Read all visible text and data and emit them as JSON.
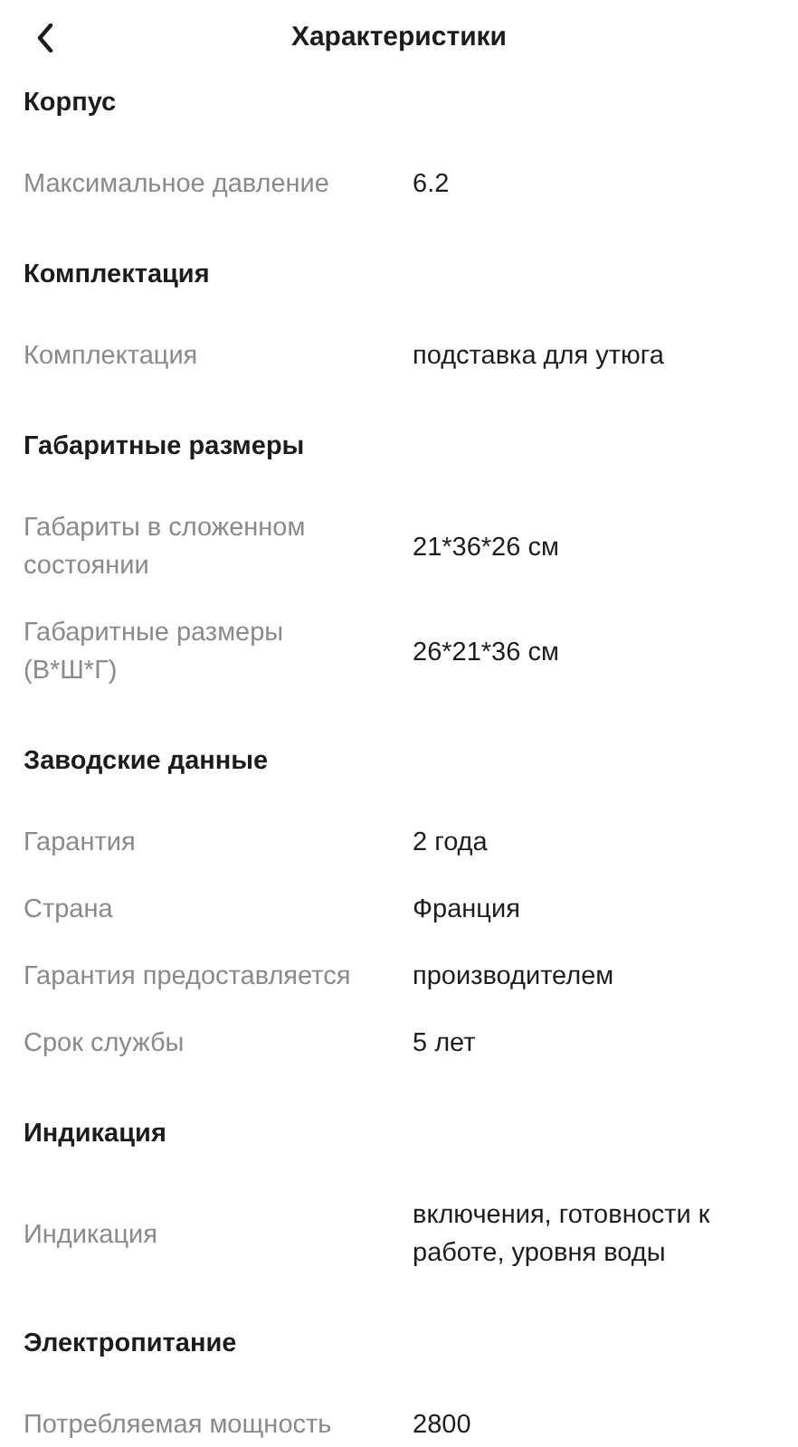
{
  "header": {
    "title": "Характеристики"
  },
  "sections": [
    {
      "title": "Корпус",
      "rows": [
        {
          "label": "Максимальное давление",
          "value": "6.2"
        }
      ]
    },
    {
      "title": "Комплектация",
      "rows": [
        {
          "label": "Комплектация",
          "value": "подставка для утюга"
        }
      ]
    },
    {
      "title": "Габаритные размеры",
      "rows": [
        {
          "label": "Габариты в сложенном состоянии",
          "value": "21*36*26 см"
        },
        {
          "label": "Габаритные размеры (В*Ш*Г)",
          "value": "26*21*36 см"
        }
      ]
    },
    {
      "title": "Заводские данные",
      "rows": [
        {
          "label": "Гарантия",
          "value": "2 года"
        },
        {
          "label": "Страна",
          "value": "Франция"
        },
        {
          "label": "Гарантия предоставляется",
          "value": "производителем"
        },
        {
          "label": "Срок службы",
          "value": "5 лет"
        }
      ]
    },
    {
      "title": "Индикация",
      "rows": [
        {
          "label": "Индикация",
          "value": "включения, готовности к работе, уровня воды"
        }
      ]
    },
    {
      "title": "Электропитание",
      "rows": [
        {
          "label": "Потребляемая мощность",
          "value": "2800"
        }
      ]
    }
  ]
}
